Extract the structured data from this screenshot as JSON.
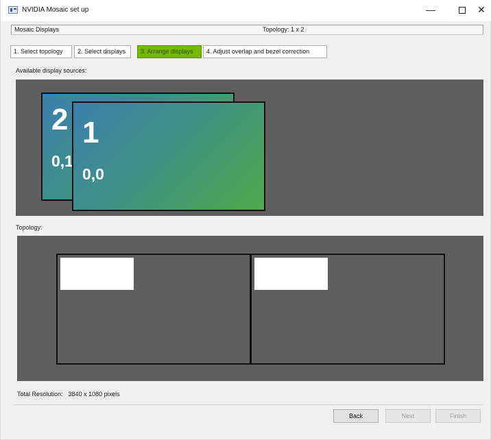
{
  "window": {
    "title": "NVIDIA Mosaic set up",
    "controls": {
      "minimize": "—",
      "close": "✕"
    }
  },
  "info_bar": {
    "left": "Mosaic Displays",
    "right": "Topology: 1 x 2"
  },
  "steps": [
    {
      "label": "1. Select topology",
      "active": false
    },
    {
      "label": "2. Select displays",
      "active": false
    },
    {
      "label": "3. Arrange displays",
      "active": true
    },
    {
      "label": "4. Adjust overlap and bezel correction",
      "active": false
    }
  ],
  "available": {
    "label": "Available display sources:",
    "displays": [
      {
        "number": "2",
        "coord": "0,1"
      },
      {
        "number": "1",
        "coord": "0,0"
      }
    ]
  },
  "topology": {
    "label": "Topology:"
  },
  "resolution": {
    "label": "Total Resolution:",
    "value": "3840 x 1080 pixels"
  },
  "buttons": {
    "back": "Back",
    "next": "Next",
    "finish": "Finish"
  },
  "colors": {
    "active_step": "#76b900",
    "panel_bg": "#5f5f5f",
    "display_gradient_start": "#3a7fab",
    "display_gradient_end": "#4ea94a"
  }
}
